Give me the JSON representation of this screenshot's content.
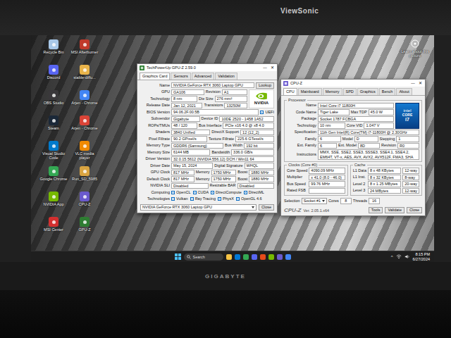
{
  "photo": {
    "monitor_brand": "ViewSonic",
    "laptop_brand": "GIGABYTE"
  },
  "desktop_icons": [
    {
      "label": "Recycle Bin",
      "color": "#a8c8e8"
    },
    {
      "label": "MSI Afterburner",
      "color": "#c0392b"
    },
    {
      "label": "Discord",
      "color": "#5865f2"
    },
    {
      "label": "stable-diffu...",
      "color": "#e8b34a"
    },
    {
      "label": "OBS Studio",
      "color": "#3a383b"
    },
    {
      "label": "Arjen - Chrome",
      "color": "#4285f4"
    },
    {
      "label": "Steam",
      "color": "#1b2838"
    },
    {
      "label": "Arjen - Chrome",
      "color": "#db4437"
    },
    {
      "label": "Visual Studio Code",
      "color": "#007acc"
    },
    {
      "label": "VLC media player",
      "color": "#f08a00"
    },
    {
      "label": "Google Chrome",
      "color": "#34a853"
    },
    {
      "label": "Run_SD_5985",
      "color": "#d9a441"
    },
    {
      "label": "NVIDIA App",
      "color": "#76b900"
    },
    {
      "label": "CPU-Z",
      "color": "#6a5acd"
    },
    {
      "label": "MSI Center",
      "color": "#d32f2f"
    },
    {
      "label": "GPU-Z",
      "color": "#2e7d32"
    }
  ],
  "learn_more": {
    "label": "Learn about this picture"
  },
  "gpuz": {
    "title": "TechPowerUp GPU-Z 2.59.0",
    "controls": [
      "—",
      "✕"
    ],
    "tabs": [
      {
        "label": "Graphics Card",
        "selected": true
      },
      {
        "label": "Sensors",
        "selected": false
      },
      {
        "label": "Advanced",
        "selected": false
      },
      {
        "label": "Validation",
        "selected": false
      }
    ],
    "logo": "NVIDIA",
    "rows": [
      {
        "kind": "fields",
        "fields": [
          {
            "label": "Name",
            "value": "NVIDIA GeForce RTX 3060 Laptop GPU"
          }
        ],
        "button": "Lookup"
      },
      {
        "kind": "fields",
        "fields": [
          {
            "label": "GPU",
            "value": "GA106"
          },
          {
            "label": "Revision",
            "value": "A1"
          }
        ]
      },
      {
        "kind": "fields",
        "fields": [
          {
            "label": "Technology",
            "value": "8 nm"
          },
          {
            "label": "Die Size",
            "value": "276 mm²"
          }
        ]
      },
      {
        "kind": "fields",
        "fields": [
          {
            "label": "Release Date",
            "value": "Jan 12, 2021"
          },
          {
            "label": "Transistors",
            "value": "13250M"
          }
        ]
      },
      {
        "kind": "fields",
        "fields": [
          {
            "label": "BIOS Version",
            "value": "94.06.2F.00.5B"
          }
        ],
        "check": {
          "label": "UEFI",
          "checked": true
        }
      },
      {
        "kind": "fields",
        "fields": [
          {
            "label": "Subvendor",
            "value": "Gigabyte"
          },
          {
            "label": "Device ID",
            "value": "10DE 2520 - 1458 1A52"
          }
        ]
      },
      {
        "kind": "fields",
        "fields": [
          {
            "label": "ROPs/TMUs",
            "value": "48 / 120"
          },
          {
            "label": "Bus Interface",
            "value": "PCIe x16 4.0 @ x8 4.0"
          }
        ]
      },
      {
        "kind": "fields",
        "fields": [
          {
            "label": "Shaders",
            "value": "3840 Unified"
          },
          {
            "label": "DirectX Support",
            "value": "12 (12_2)"
          }
        ]
      },
      {
        "kind": "fields",
        "fields": [
          {
            "label": "Pixel Fillrate",
            "value": "90.2 GPixel/s"
          },
          {
            "label": "Texture Fillrate",
            "value": "225.6 GTexel/s"
          }
        ]
      },
      {
        "kind": "fields",
        "fields": [
          {
            "label": "Memory Type",
            "value": "GDDR6 (Samsung)"
          },
          {
            "label": "Bus Width",
            "value": "192 bit"
          }
        ]
      },
      {
        "kind": "fields",
        "fields": [
          {
            "label": "Memory Size",
            "value": "6144 MB"
          },
          {
            "label": "Bandwidth",
            "value": "336.0 GB/s"
          }
        ]
      },
      {
        "kind": "fields",
        "fields": [
          {
            "label": "Driver Version",
            "value": "32.0.15.5612 (NVIDIA 556.12) DCH / Win11 64"
          }
        ]
      },
      {
        "kind": "fields",
        "fields": [
          {
            "label": "Driver Date",
            "value": "May 15, 2024"
          },
          {
            "label": "Digital Signature",
            "value": "WHQL"
          }
        ]
      },
      {
        "kind": "fields",
        "fields": [
          {
            "label": "GPU Clock",
            "value": "817 MHz"
          },
          {
            "label": "Memory",
            "value": "1750 MHz"
          },
          {
            "label": "Boost",
            "value": "1880 MHz"
          }
        ]
      },
      {
        "kind": "fields",
        "fields": [
          {
            "label": "Default Clock",
            "value": "817 MHz"
          },
          {
            "label": "Memory",
            "value": "1750 MHz"
          },
          {
            "label": "Boost",
            "value": "1880 MHz"
          }
        ]
      },
      {
        "kind": "fields",
        "fields": [
          {
            "label": "NVIDIA SLI",
            "value": "Disabled"
          },
          {
            "label": "Resizable BAR",
            "value": "Disabled"
          }
        ]
      },
      {
        "kind": "checks",
        "label": "Computing",
        "items": [
          {
            "label": "OpenCL",
            "checked": true
          },
          {
            "label": "CUDA",
            "checked": true
          },
          {
            "label": "DirectCompute",
            "checked": true
          },
          {
            "label": "DirectML",
            "checked": true
          }
        ]
      },
      {
        "kind": "checks",
        "label": "Technologies",
        "items": [
          {
            "label": "Vulkan",
            "checked": true
          },
          {
            "label": "Ray Tracing",
            "checked": true
          },
          {
            "label": "PhysX",
            "checked": true
          },
          {
            "label": "OpenGL 4.6",
            "checked": true
          }
        ]
      }
    ],
    "device_select": "NVIDIA GeForce RTX 3060 Laptop GPU",
    "close": "Close"
  },
  "cpuz": {
    "title": "CPU-Z",
    "controls": [
      "—",
      "✕"
    ],
    "tabs": [
      {
        "label": "CPU",
        "selected": true
      },
      {
        "label": "Mainboard",
        "selected": false
      },
      {
        "label": "Memory",
        "selected": false
      },
      {
        "label": "SPD",
        "selected": false
      },
      {
        "label": "Graphics",
        "selected": false
      },
      {
        "label": "Bench",
        "selected": false
      },
      {
        "label": "About",
        "selected": false
      }
    ],
    "processor": {
      "legend": "Processor",
      "logo": {
        "brand": "intel",
        "line": "CORE",
        "tier": "i7"
      },
      "rows": [
        {
          "fields": [
            {
              "label": "Name",
              "value": "Intel Core i7 11800H"
            }
          ]
        },
        {
          "fields": [
            {
              "label": "Code Name",
              "value": "Tiger Lake"
            },
            {
              "label": "Max TDP",
              "value": "45.0 W"
            }
          ]
        },
        {
          "fields": [
            {
              "label": "Package",
              "value": "Socket 1787 FCBGA"
            }
          ]
        },
        {
          "fields": [
            {
              "label": "Technology",
              "value": "10 nm"
            },
            {
              "label": "Core VID",
              "value": "1.047 V"
            }
          ]
        },
        {
          "fields": [
            {
              "label": "Specification",
              "value": "11th Gen Intel(R) Core(TM) i7-11800H @ 2.30GHz"
            }
          ]
        },
        {
          "fields": [
            {
              "label": "Family",
              "value": "6"
            },
            {
              "label": "Model",
              "value": "D"
            },
            {
              "label": "Stepping",
              "value": "1"
            }
          ]
        },
        {
          "fields": [
            {
              "label": "Ext. Family",
              "value": "6"
            },
            {
              "label": "Ext. Model",
              "value": "8D"
            },
            {
              "label": "Revision",
              "value": "R0"
            }
          ]
        },
        {
          "fields": [
            {
              "label": "Instructions",
              "value": "MMX, SSE, SSE2, SSE3, SSSE3, SSE4.1, SSE4.2, EM64T, VT-x, AES, AVX, AVX2, AVX512F, FMA3, SHA"
            }
          ]
        }
      ]
    },
    "clocks": {
      "legend": "Clocks (Core #0)",
      "rows": [
        {
          "label": "Core Speed",
          "value": "4090.09 MHz"
        },
        {
          "label": "Multiplier",
          "value": "x 41.0 (8.0 - 46.0)"
        },
        {
          "label": "Bus Speed",
          "value": "99.76 MHz"
        },
        {
          "label": "Rated FSB",
          "value": ""
        }
      ]
    },
    "cache": {
      "legend": "Cache",
      "rows": [
        {
          "label": "L1 Data",
          "size": "8 x 48 KBytes",
          "ways": "12-way"
        },
        {
          "label": "L1 Inst.",
          "size": "8 x 32 KBytes",
          "ways": "8-way"
        },
        {
          "label": "Level 2",
          "size": "8 x 1.25 MBytes",
          "ways": "20-way"
        },
        {
          "label": "Level 3",
          "size": "24 MBytes",
          "ways": "12-way"
        }
      ]
    },
    "selection": {
      "label": "Selection",
      "value": "Socket #1",
      "cores_label": "Cores",
      "cores": "8",
      "threads_label": "Threads",
      "threads": "16"
    },
    "footer": {
      "brand": "CPU-Z",
      "version": "Ver. 2.05.1.x64",
      "buttons": [
        "Tools",
        "Validate",
        "Close"
      ]
    }
  },
  "taskbar": {
    "search": {
      "placeholder": "Search"
    },
    "apps": [
      {
        "color": "#f6c344"
      },
      {
        "color": "#0078d4"
      },
      {
        "color": "#34a853"
      },
      {
        "color": "#5865f2"
      },
      {
        "color": "#e64a19"
      },
      {
        "color": "#76b900"
      },
      {
        "color": "#6a5acd"
      },
      {
        "color": "#4285f4"
      }
    ],
    "tray_chevron": "^",
    "time": "8:15 PM",
    "date": "6/27/2024"
  }
}
